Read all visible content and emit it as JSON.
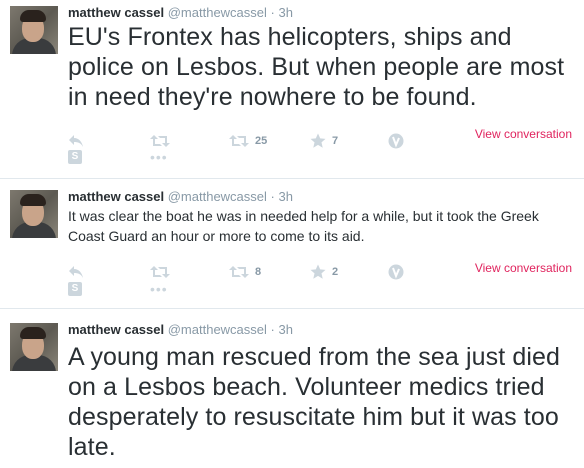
{
  "tweets": [
    {
      "fullname": "matthew cassel",
      "handle": "@matthewcassel",
      "separator": "·",
      "time": "3h",
      "text": "EU's Frontex has helicopters, ships and police on Lesbos. But when people are most in need they're nowhere to be found.",
      "retweets": "25",
      "favorites": "7",
      "view_conversation": "View conversation"
    },
    {
      "fullname": "matthew cassel",
      "handle": "@matthewcassel",
      "separator": "·",
      "time": "3h",
      "text": "It was clear the boat he was in needed help for a while, but it took the Greek Coast Guard an hour or more to come to its aid.",
      "retweets": "8",
      "favorites": "2",
      "view_conversation": "View conversation"
    },
    {
      "fullname": "matthew cassel",
      "handle": "@matthewcassel",
      "separator": "·",
      "time": "3h",
      "text": "A young man rescued from the sea just died on a Lesbos beach. Volunteer medics tried desperately to resuscitate him but it was too late."
    }
  ],
  "icons": {
    "s_glyph": "S",
    "more_glyph": "•••"
  },
  "colors": {
    "accent": "#e0245e",
    "muted": "#8899a6",
    "icon": "#ccd6dd",
    "text": "#292f33"
  }
}
